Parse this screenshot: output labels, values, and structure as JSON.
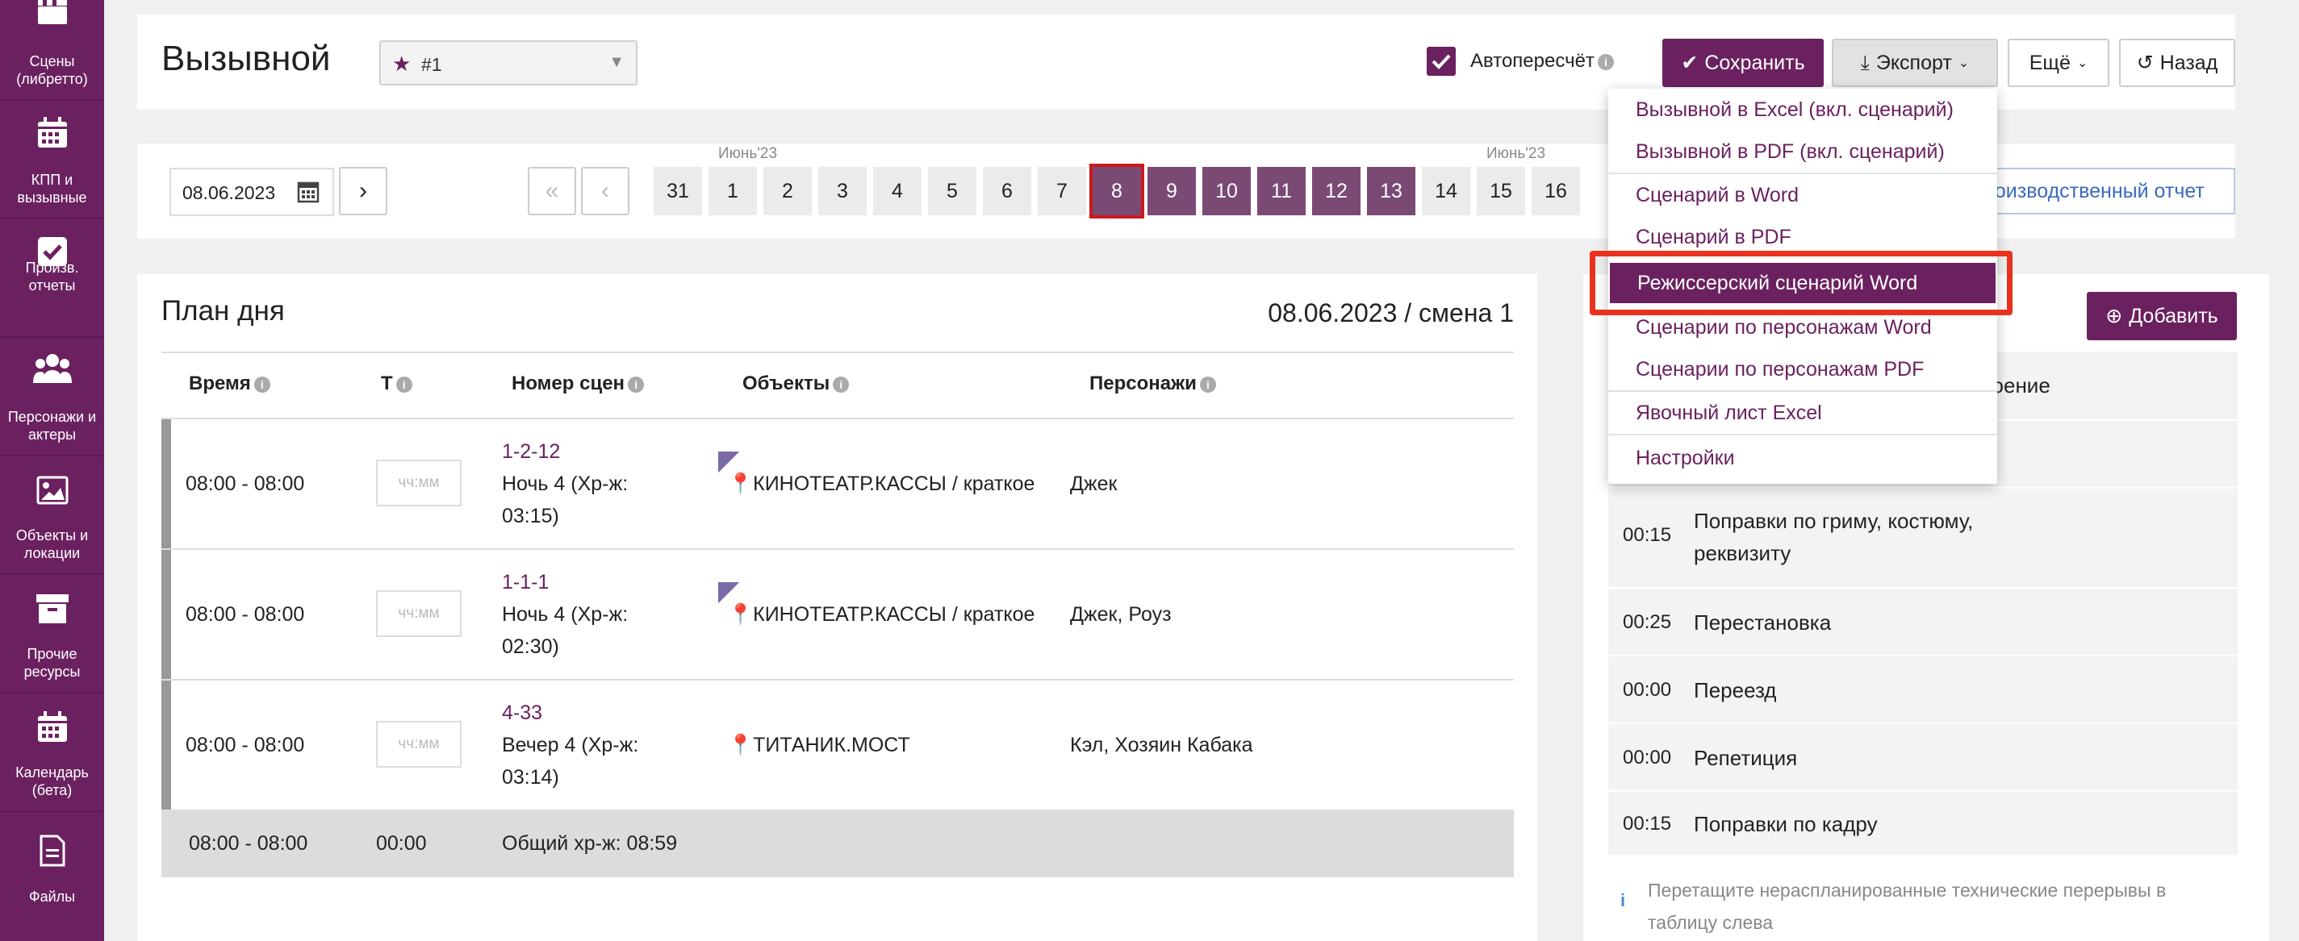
{
  "sidebar": {
    "items": [
      {
        "label": "Сцены (либретто)",
        "icon": "clapperboard-icon"
      },
      {
        "label": "КПП и вызывные",
        "icon": "calendar-icon"
      },
      {
        "label": "Произв. отчеты",
        "icon": "checkbox-icon"
      },
      {
        "label": "Персонажи и актеры",
        "icon": "people-icon"
      },
      {
        "label": "Объекты и локации",
        "icon": "image-icon"
      },
      {
        "label": "Прочие ресурсы",
        "icon": "archive-icon"
      },
      {
        "label": "Календарь (бета)",
        "icon": "calendar-icon"
      },
      {
        "label": "Файлы",
        "icon": "file-icon"
      }
    ]
  },
  "header": {
    "title": "Вызывной",
    "select_value": "#1",
    "autorecalc_label": "Автопересчёт",
    "autorecalc_checked": true,
    "save_label": "Сохранить",
    "export_label": "Экспорт",
    "more_label": "Ещё",
    "back_label": "Назад"
  },
  "datebar": {
    "date_value": "08.06.2023",
    "next_symbol": "›",
    "first_symbol": "«",
    "prev_symbol": "‹",
    "month_left": "Июнь'23",
    "month_right": "Июнь'23",
    "days": [
      "31",
      "1",
      "2",
      "3",
      "4",
      "5",
      "6",
      "7",
      "8",
      "9",
      "10",
      "11",
      "12",
      "13",
      "14",
      "15",
      "16"
    ],
    "current_day": "8",
    "highlighted_days": [
      "9",
      "10",
      "11",
      "12",
      "13"
    ],
    "report_link": "роизводственный отчет"
  },
  "plan": {
    "title": "План дня",
    "date_shift": "08.06.2023 / смена 1",
    "columns": [
      "Время",
      "Т",
      "Номер сцен",
      "Объекты",
      "Персонажи"
    ],
    "time_placeholder": "чч:мм",
    "rows": [
      {
        "time": "08:00 - 08:00",
        "scene_no": "1-2-12",
        "scene_desc1": "Ночь 4 (Хр-ж:",
        "scene_desc2": "03:15)",
        "object": "КИНОТЕАТР.КАССЫ / краткое",
        "characters": "Джек",
        "flag": true
      },
      {
        "time": "08:00 - 08:00",
        "scene_no": "1-1-1",
        "scene_desc1": "Ночь 4 (Хр-ж:",
        "scene_desc2": "02:30)",
        "object": "КИНОТЕАТР.КАССЫ / краткое",
        "characters": "Джек, Роуз",
        "flag": true
      },
      {
        "time": "08:00 - 08:00",
        "scene_no": "4-33",
        "scene_desc1": "Вечер 4 (Хр-ж:",
        "scene_desc2": "03:14)",
        "object": "ТИТАНИК.МОСТ",
        "characters": "Кэл, Хозяин Кабака",
        "flag": false
      }
    ],
    "total": {
      "time": "08:00 - 08:00",
      "t": "00:00",
      "label": "Общий хр-ж: 08:59"
    }
  },
  "export_menu": {
    "items": [
      "Вызывной в Excel (вкл. сценарий)",
      "Вызывной в PDF (вкл. сценарий)",
      "Сценарий в Word",
      "Сценарий в PDF",
      "Режиссерский сценарий Word",
      "Сценарии по персонажам Word",
      "Сценарии по персонажам PDF",
      "Явочный лист Excel",
      "Настройки"
    ],
    "active_index": 4
  },
  "breaks": {
    "add_label": "Добавить",
    "header_partial": "воение",
    "rows": [
      {
        "time": "00:15",
        "name1": "Поправки по гриму, костюму,",
        "name2": "реквизиту"
      },
      {
        "time": "00:25",
        "name1": "Перестановка",
        "name2": ""
      },
      {
        "time": "00:00",
        "name1": "Переезд",
        "name2": ""
      },
      {
        "time": "00:00",
        "name1": "Репетиция",
        "name2": ""
      },
      {
        "time": "00:15",
        "name1": "Поправки по кадру",
        "name2": ""
      }
    ],
    "hint1": "Перетащите нераспланированные технические перерывы в",
    "hint2": "таблицу слева"
  },
  "colors": {
    "brand": "#6b2160",
    "highlight_border": "#e8321e"
  }
}
